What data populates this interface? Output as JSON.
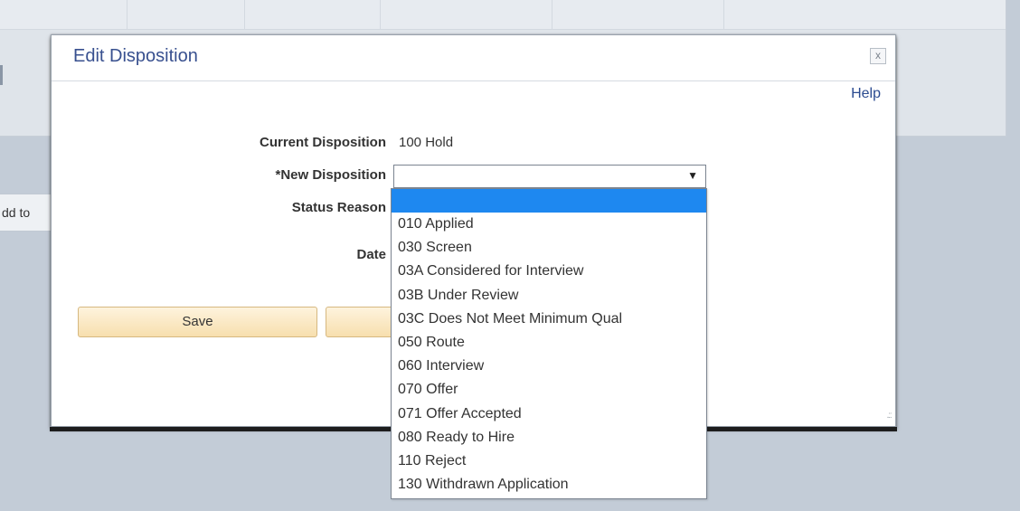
{
  "background": {
    "side_text": "dd to"
  },
  "dialog": {
    "title": "Edit Disposition",
    "close_label": "x",
    "help_label": "Help",
    "current_disposition_label": "Current Disposition",
    "current_disposition_value": "100 Hold",
    "new_disposition_label": "*New Disposition",
    "new_disposition_value": "",
    "status_reason_label": "Status Reason",
    "date_label": "Date",
    "save_label": "Save"
  },
  "dropdown": {
    "selected_index": 0,
    "options": [
      "",
      "010 Applied",
      "030 Screen",
      "03A Considered for Interview",
      "03B Under Review",
      "03C Does Not Meet Minimum Qual",
      "050 Route",
      "060 Interview",
      "070 Offer",
      "071 Offer Accepted",
      "080 Ready to Hire",
      "110 Reject",
      "130 Withdrawn Application"
    ]
  },
  "colors": {
    "title": "#38508f",
    "link": "#2b4b90",
    "highlight": "#1e88f0",
    "button_fill": "#f7dfae"
  },
  "icons": {
    "close": "close-icon",
    "dropdown_arrow": "chevron-down-icon",
    "resize": "resize-grip-icon"
  }
}
